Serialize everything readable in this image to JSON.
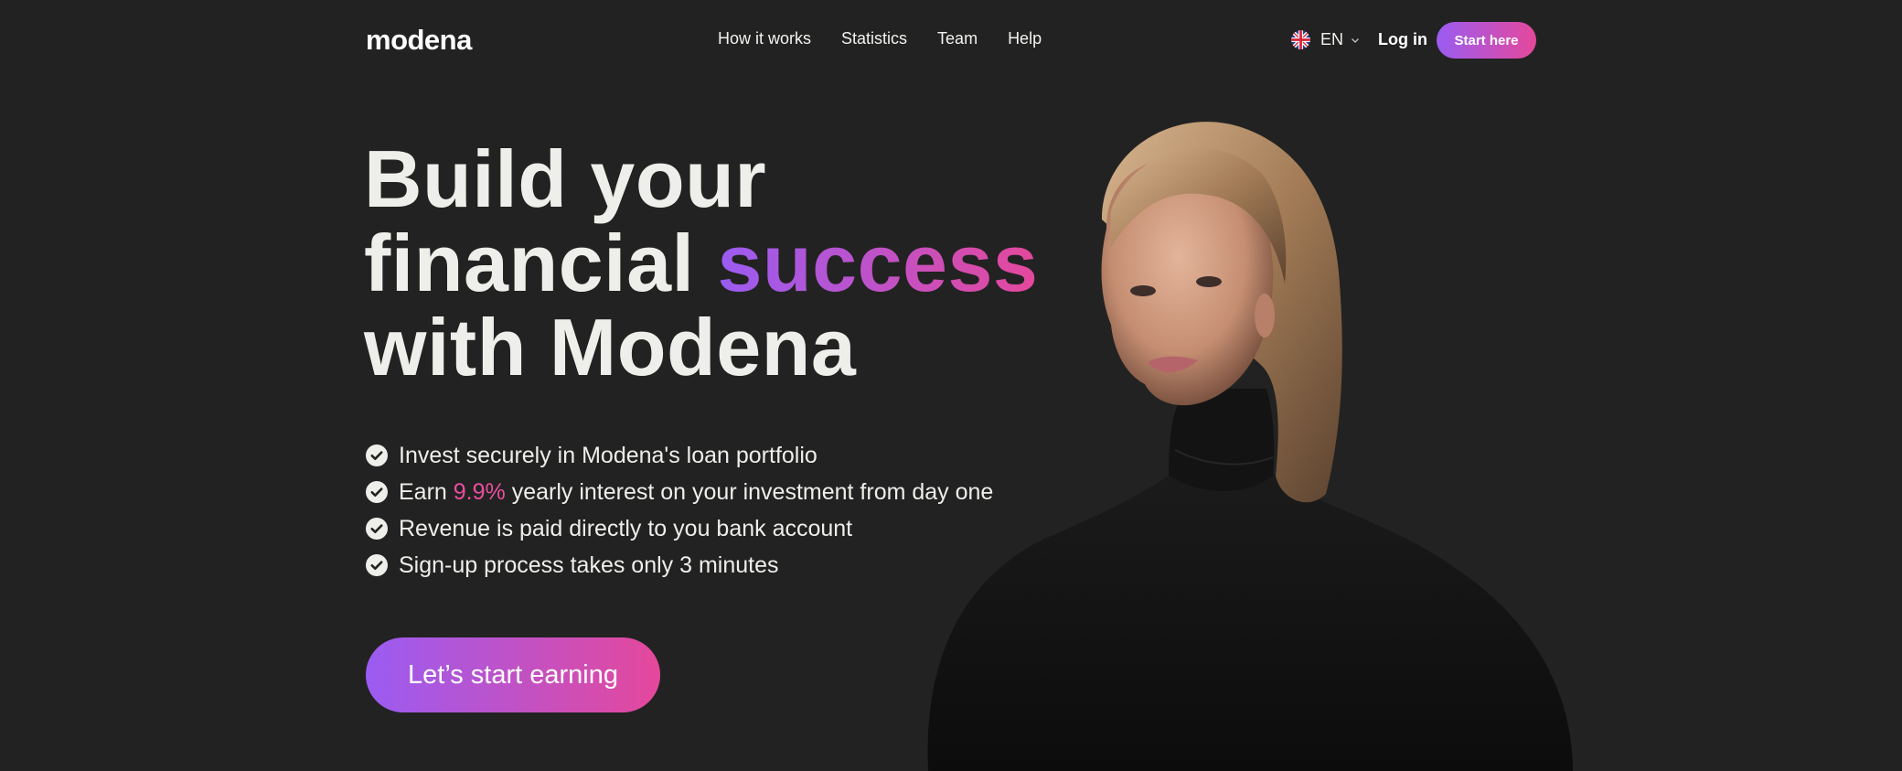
{
  "header": {
    "logo": "modena",
    "nav": [
      "How it works",
      "Statistics",
      "Team",
      "Help"
    ],
    "language": {
      "flag_icon": "uk-flag-icon",
      "label": "EN"
    },
    "login_label": "Log in",
    "start_label": "Start here"
  },
  "hero": {
    "headline": {
      "line1": "Build your",
      "line2_plain": "financial ",
      "line2_accent": "success",
      "line3": "with Modena"
    },
    "features": [
      {
        "text": "Invest securely in Modena's loan portfolio"
      },
      {
        "before": "Earn ",
        "highlight": "9.9%",
        "after": " yearly interest on your investment from day one"
      },
      {
        "text": "Revenue is paid directly to you bank account"
      },
      {
        "text": "Sign-up process takes only 3 minutes"
      }
    ],
    "cta_label": "Let’s start earning"
  },
  "colors": {
    "background": "#222222",
    "text": "#eeeeea",
    "gradient_start": "#9a5cf2",
    "gradient_end": "#e5489b",
    "highlight": "#ea4f9e"
  }
}
